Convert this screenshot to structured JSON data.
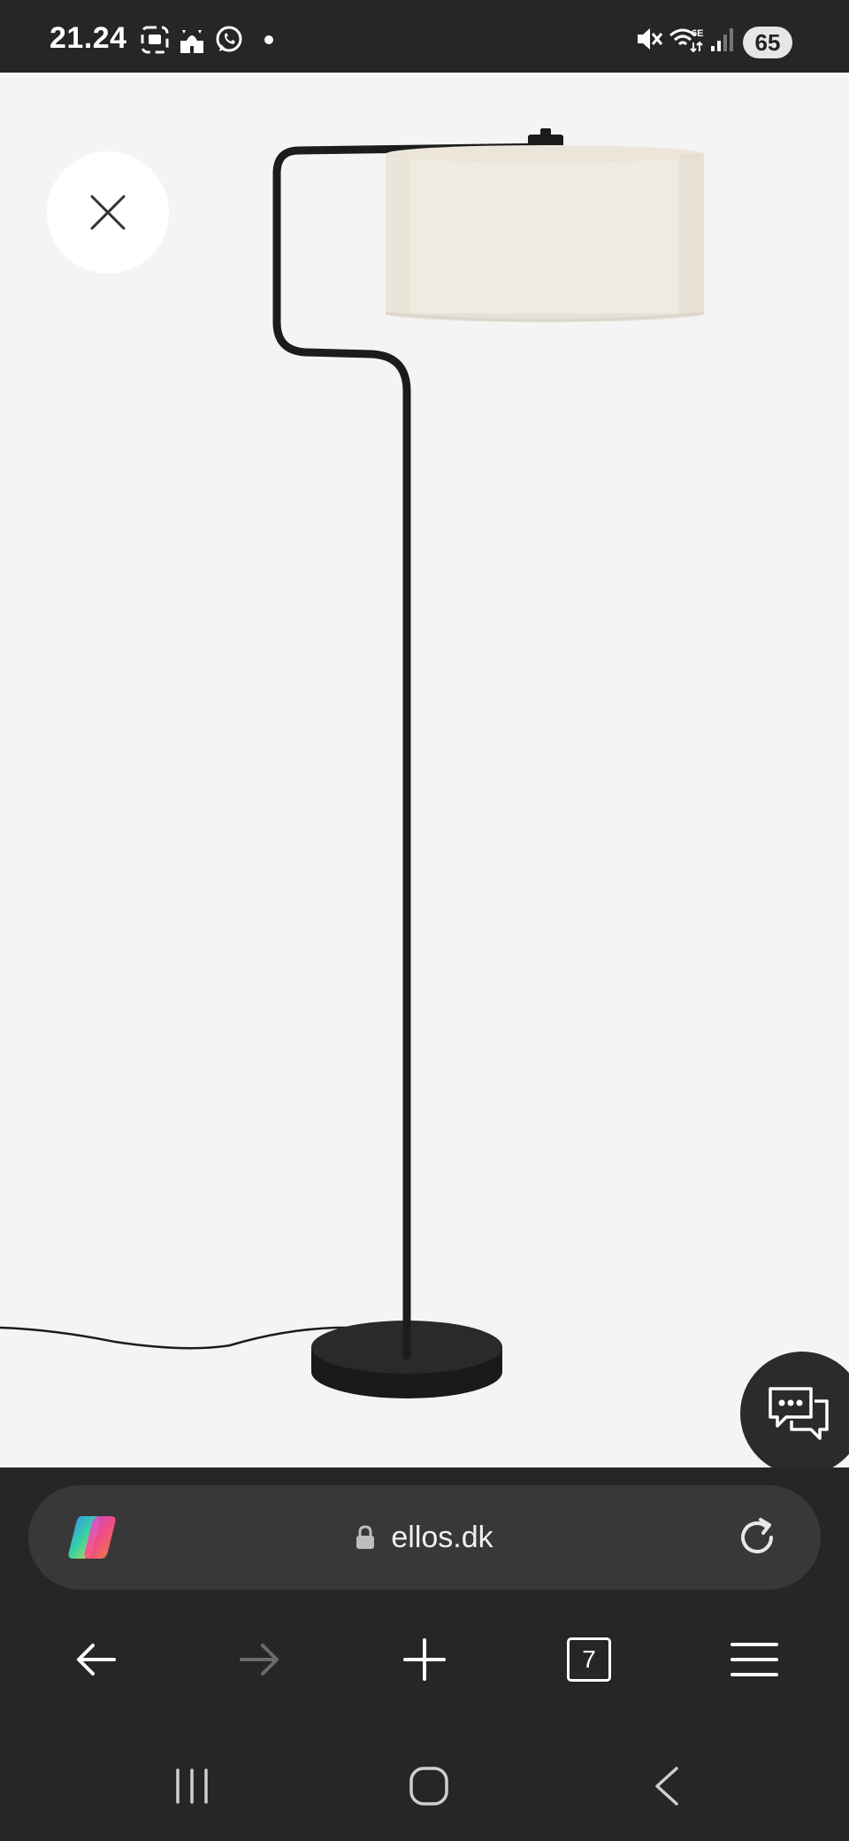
{
  "status_bar": {
    "time": "21.24",
    "battery": "65",
    "left_icons": [
      "screenshot-icon",
      "mosque-icon",
      "whatsapp-icon",
      "dot-icon"
    ],
    "right_icons": [
      "mute-icon",
      "wifi-6e-icon",
      "signal-icon"
    ]
  },
  "viewer": {
    "close_icon": "close-icon",
    "chat_icon": "chat-icon"
  },
  "browser": {
    "url": "ellos.dk",
    "copilot_icon": "copilot-icon",
    "lock_icon": "lock-icon",
    "reload_icon": "reload-icon",
    "tabs_count": "7",
    "nav": [
      "back-icon",
      "forward-icon",
      "new-tab-icon",
      "tabs-icon",
      "menu-icon"
    ]
  },
  "system_nav": [
    "recent-apps-icon",
    "home-icon",
    "back-icon"
  ],
  "colors": {
    "bar_bg": "#262626",
    "url_pill": "#383838",
    "page_bg": "#f4f4f4",
    "lamp_black": "#1c1c1c",
    "shade": "#f0ebe0"
  }
}
